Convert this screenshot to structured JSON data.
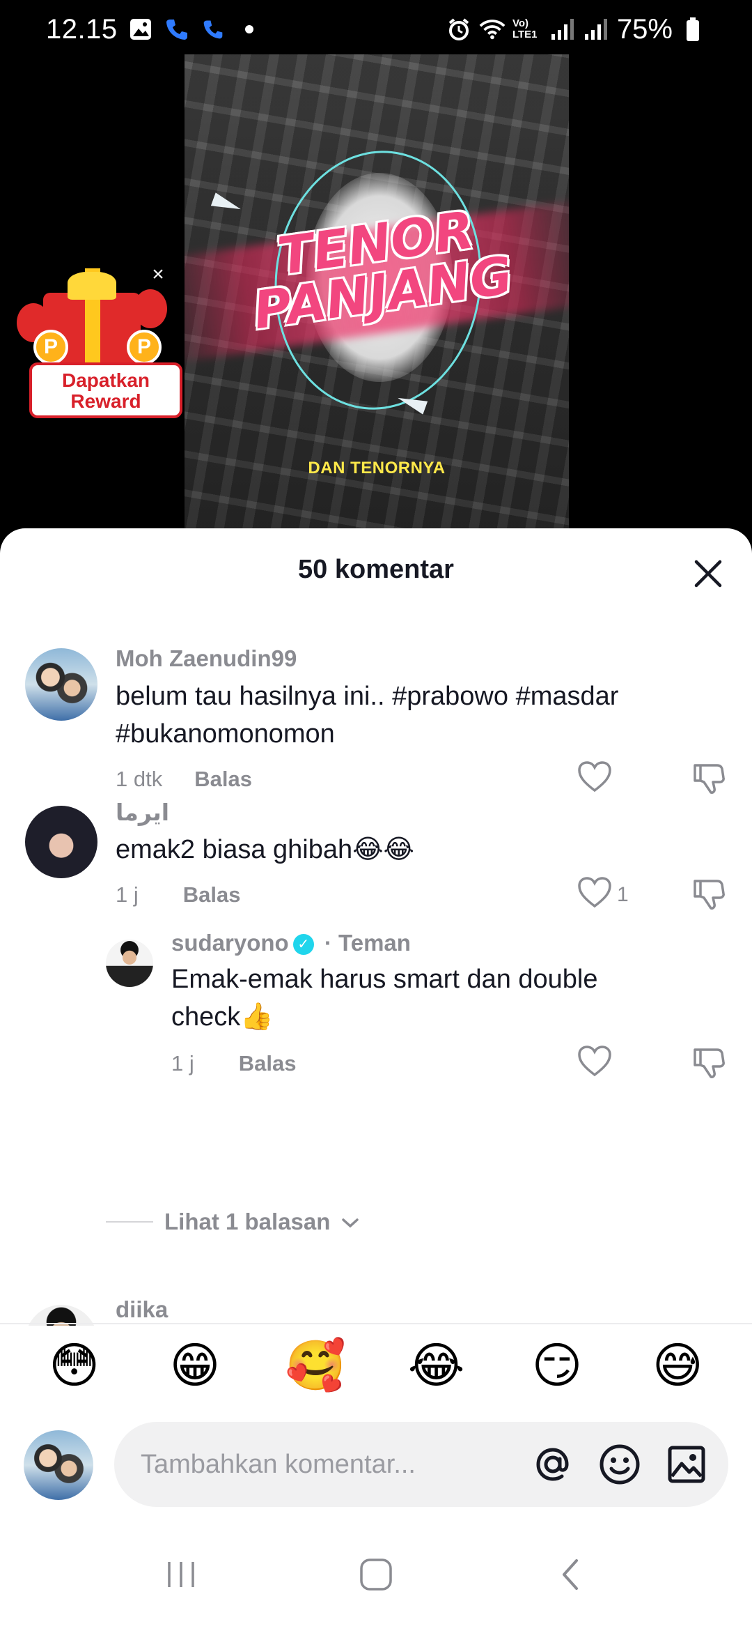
{
  "status_bar": {
    "time": "12.15",
    "battery": "75%",
    "network_label": "Vo) LTE1"
  },
  "video": {
    "title_line1": "TENOR",
    "title_line2": "PANJANG",
    "subtitle": "DAN TENORNYA"
  },
  "reward": {
    "label_line1": "Dapatkan",
    "label_line2": "Reward",
    "coin_letter": "P"
  },
  "sheet": {
    "title": "50 komentar"
  },
  "comments": [
    {
      "user": "Moh Zaenudin99",
      "text_line1": "belum tau hasilnya ini.. #prabowo #masdar",
      "text_line2": "#bukanomonomon",
      "time": "1 dtk",
      "reply": "Balas",
      "likes": ""
    },
    {
      "user": "ايرما",
      "text_line1": "emak2 biasa ghibah😂😂",
      "time": "1 j",
      "reply": "Balas",
      "likes": "1"
    }
  ],
  "reply_comment": {
    "user": "sudaryono",
    "verified_mark": "✓",
    "relation": "· Teman",
    "text_line1": "Emak-emak harus smart dan double",
    "text_line2": "check👍",
    "time": "1 j",
    "reply": "Balas"
  },
  "view_replies": {
    "label": "Lihat 1 balasan"
  },
  "next_comment": {
    "user": "diika"
  },
  "emoji_bar": [
    "😳",
    "😁",
    "🥰",
    "😂",
    "😏",
    "😅"
  ],
  "input": {
    "placeholder": "Tambahkan komentar..."
  },
  "colors": {
    "accent_verified": "#20d5ec",
    "text_primary": "#161823",
    "text_secondary": "#8a8b91",
    "reward_red": "#d8202a"
  }
}
